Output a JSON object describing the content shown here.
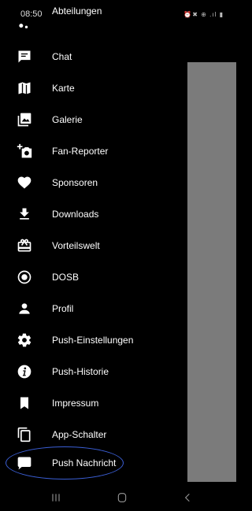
{
  "status_bar": {
    "time": "08:50",
    "icons": "⏰✖ ⊕ .ıl ▮"
  },
  "menu": [
    {
      "label": "Abteilungen",
      "icon": "groups-icon"
    },
    {
      "label": "Chat",
      "icon": "chat-icon"
    },
    {
      "label": "Karte",
      "icon": "map-icon"
    },
    {
      "label": "Galerie",
      "icon": "gallery-icon"
    },
    {
      "label": "Fan-Reporter",
      "icon": "add-photo-icon"
    },
    {
      "label": "Sponsoren",
      "icon": "heart-icon"
    },
    {
      "label": "Downloads",
      "icon": "download-icon"
    },
    {
      "label": "Vorteilswelt",
      "icon": "redeem-icon"
    },
    {
      "label": "DOSB",
      "icon": "radio-button-icon"
    },
    {
      "label": "Profil",
      "icon": "person-icon"
    },
    {
      "label": "Push-Einstellungen",
      "icon": "gear-icon"
    },
    {
      "label": "Push-Historie",
      "icon": "info-icon"
    },
    {
      "label": "Impressum",
      "icon": "bookmark-icon"
    },
    {
      "label": "App-Schalter",
      "icon": "copy-icon"
    },
    {
      "label": "Push Nachricht",
      "icon": "comment-icon"
    }
  ],
  "nav_bar": {
    "recents": "recents-icon",
    "home": "home-icon",
    "back": "back-icon"
  },
  "colors": {
    "background": "#000000",
    "scrim": "#7b7b7b",
    "highlight": "#3b5fd6"
  }
}
